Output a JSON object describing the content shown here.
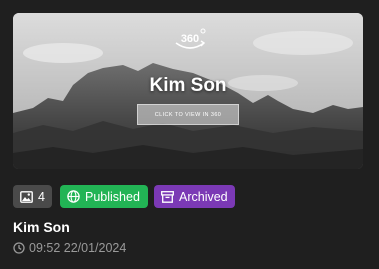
{
  "thumbnail": {
    "badge": "360°",
    "title": "Kim Son",
    "view_button": "CLICK TO VIEW IN 360"
  },
  "chips": {
    "image_count": "4",
    "published": "Published",
    "archived": "Archived"
  },
  "item": {
    "name": "Kim Son",
    "datetime": "09:52 22/01/2024"
  },
  "colors": {
    "background": "#1f1f1f",
    "published": "#22b455",
    "archived": "#7b39b5",
    "count_chip": "#4a4a4a"
  },
  "icons": [
    "image-icon",
    "globe-icon",
    "archive-icon",
    "clock-icon",
    "360-icon"
  ]
}
